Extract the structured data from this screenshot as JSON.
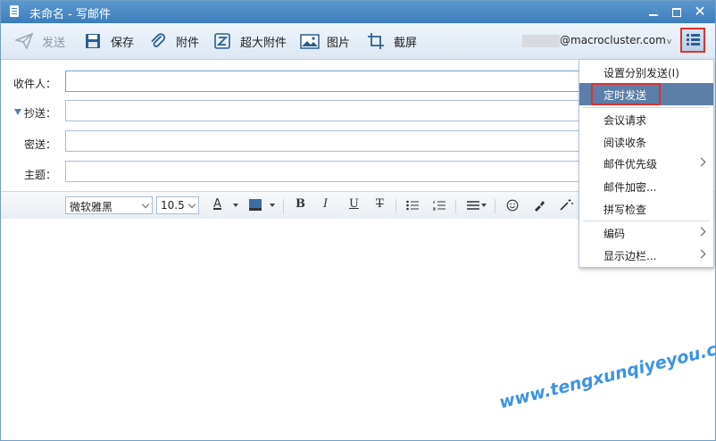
{
  "window": {
    "title": "未命名 - 写邮件"
  },
  "toolbar": {
    "send": "发送",
    "save": "保存",
    "attach": "附件",
    "large_attach": "超大附件",
    "image": "图片",
    "screenshot": "截屏",
    "account_suffix": "@macrocluster.com"
  },
  "fields": {
    "to_label": "收件人：",
    "cc_label": "抄送：",
    "bcc_label": "密送：",
    "subject_label": "主题："
  },
  "format": {
    "font": "微软雅黑",
    "size": "10.5",
    "bold": "B",
    "italic": "I",
    "underline": "U",
    "strike": "T"
  },
  "menu": {
    "items": [
      {
        "label": "设置分别发送(I)"
      },
      {
        "label": "定时发送"
      },
      {
        "label": "会议请求"
      },
      {
        "label": "阅读收条"
      },
      {
        "label": "邮件优先级"
      },
      {
        "label": "邮件加密..."
      },
      {
        "label": "拼写检查"
      },
      {
        "label": "编码"
      },
      {
        "label": "显示边栏..."
      }
    ]
  },
  "watermark": "www.tengxunqiyeyou.com",
  "colors": {
    "accent": "#3c7dbb",
    "highlight": "#5d7ea8",
    "annotation": "#e0302d"
  }
}
